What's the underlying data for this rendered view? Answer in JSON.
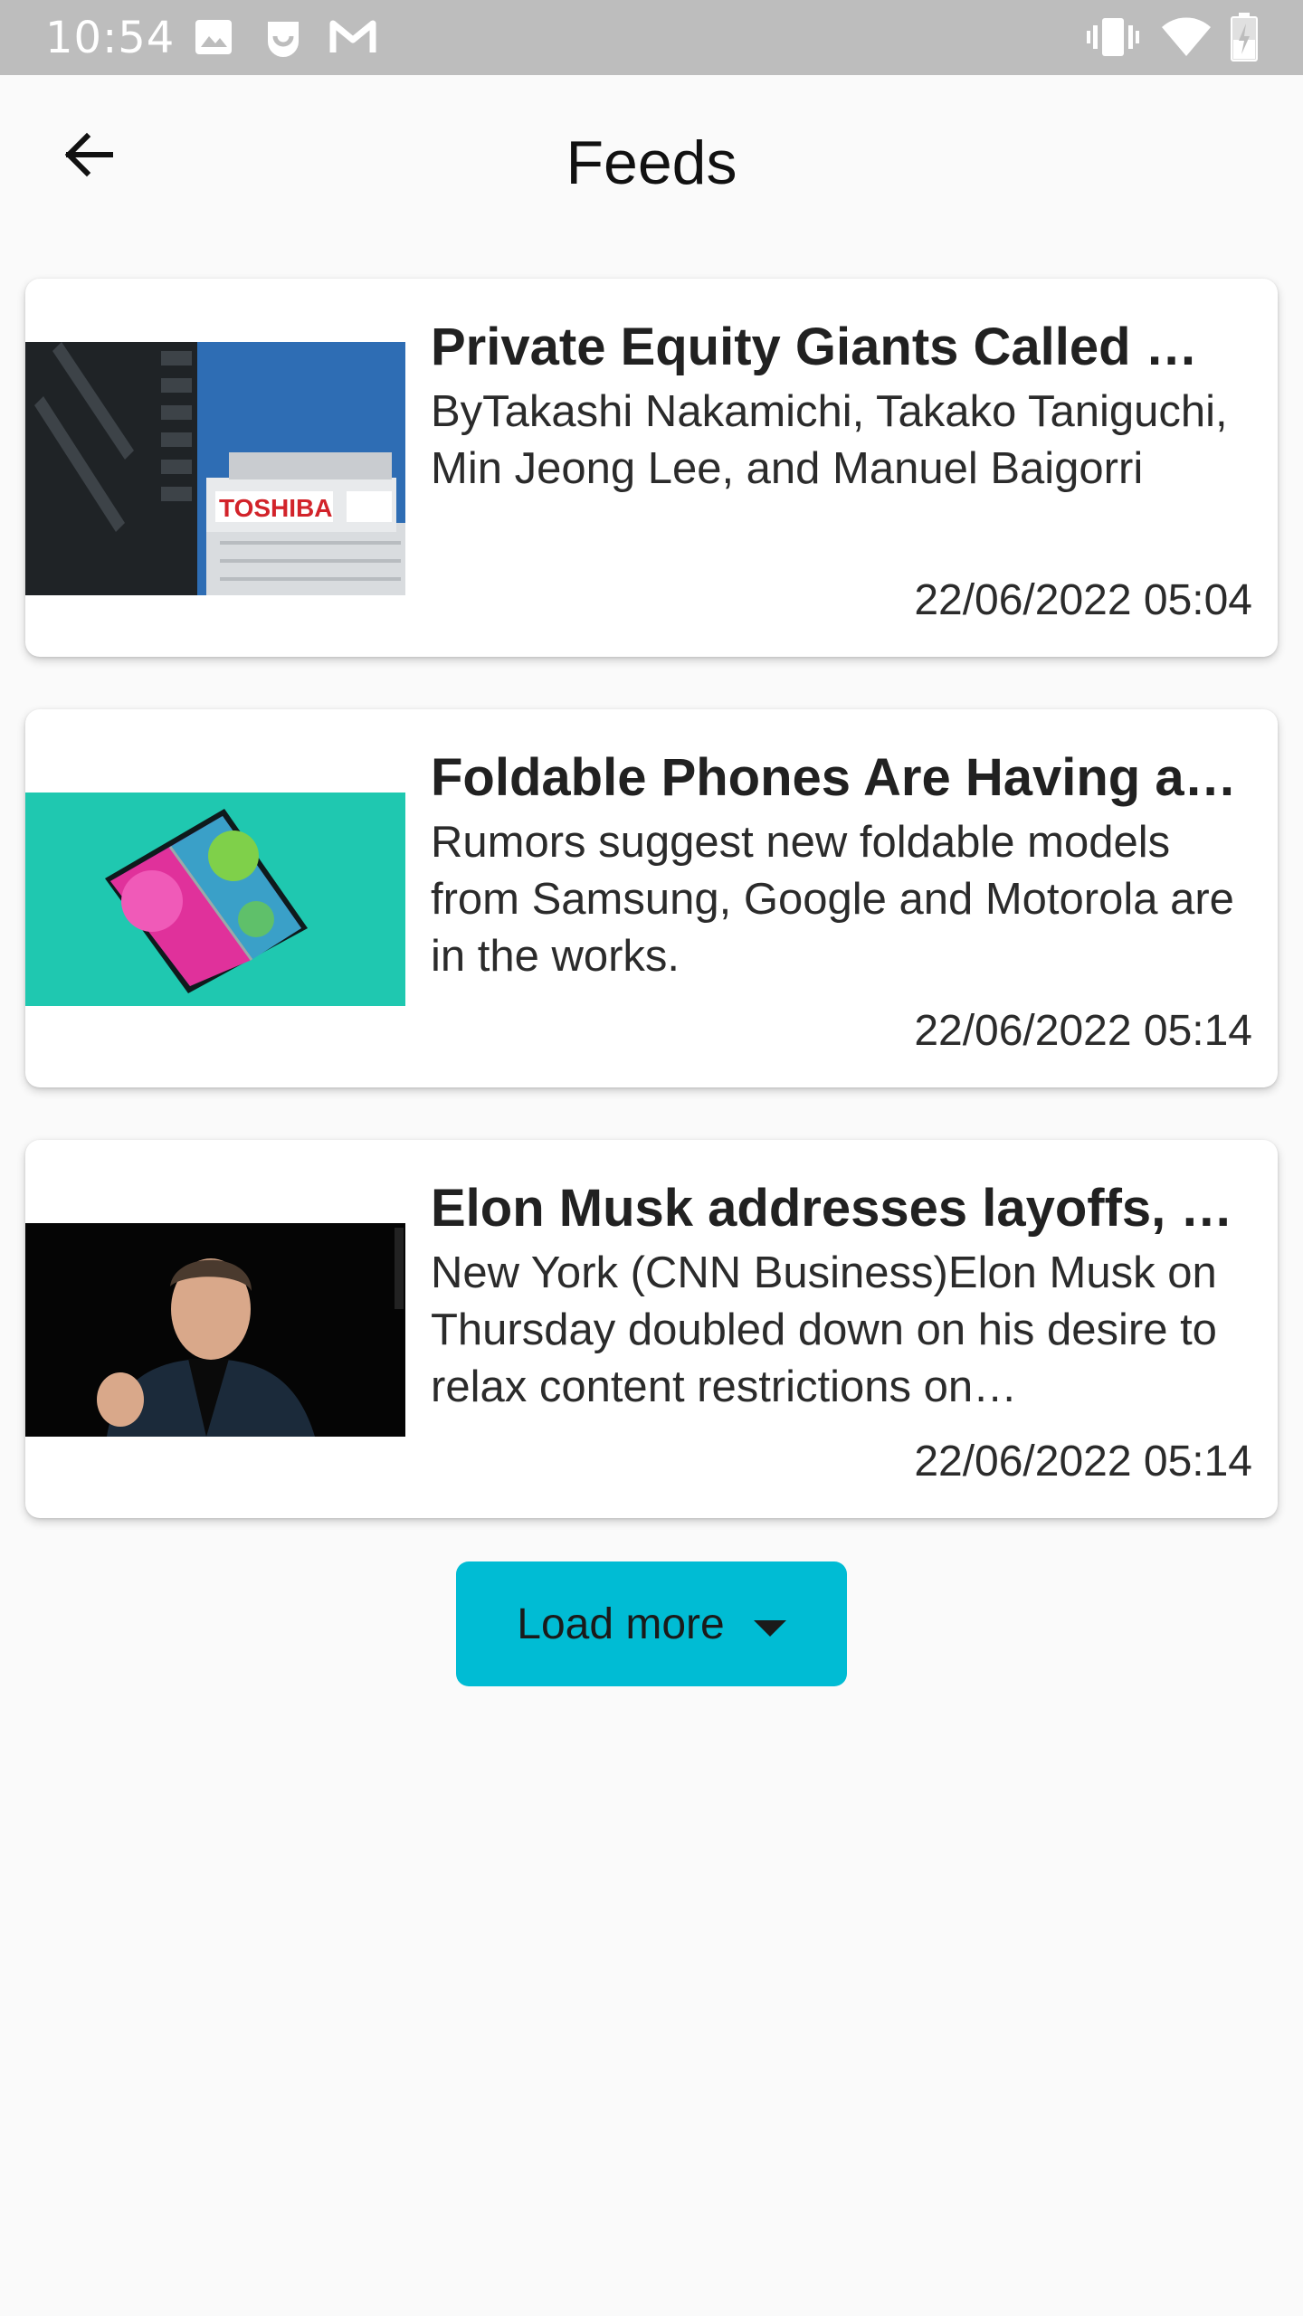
{
  "status_bar": {
    "time": "10:54",
    "left_icons": [
      "image-icon",
      "messenger-icon",
      "gmail-icon"
    ],
    "right_icons": [
      "vibrate-icon",
      "wifi-icon",
      "battery-charging-icon"
    ]
  },
  "app_bar": {
    "title": "Feeds",
    "back_icon": "arrow-back-icon"
  },
  "feeds": [
    {
      "title": "Private Equity Giants Called …",
      "description": "ByTakashi Nakamichi, Takako Taniguchi, Min Jeong Lee, and Manuel Baigorri",
      "date": "22/06/2022 05:04",
      "image_label": "TOSHIBA"
    },
    {
      "title": "Foldable Phones Are Having a…",
      "description": "Rumors suggest new foldable models from Samsung, Google and Motorola are in the works.",
      "date": "22/06/2022 05:14"
    },
    {
      "title": "Elon Musk addresses layoffs, …",
      "description": "New York (CNN Business)Elon Musk on Thursday doubled down on his desire to relax content restrictions on…",
      "date": "22/06/2022 05:14"
    }
  ],
  "load_more": {
    "label": "Load more",
    "icon": "arrow-drop-down-icon",
    "color": "#00bcd4"
  }
}
